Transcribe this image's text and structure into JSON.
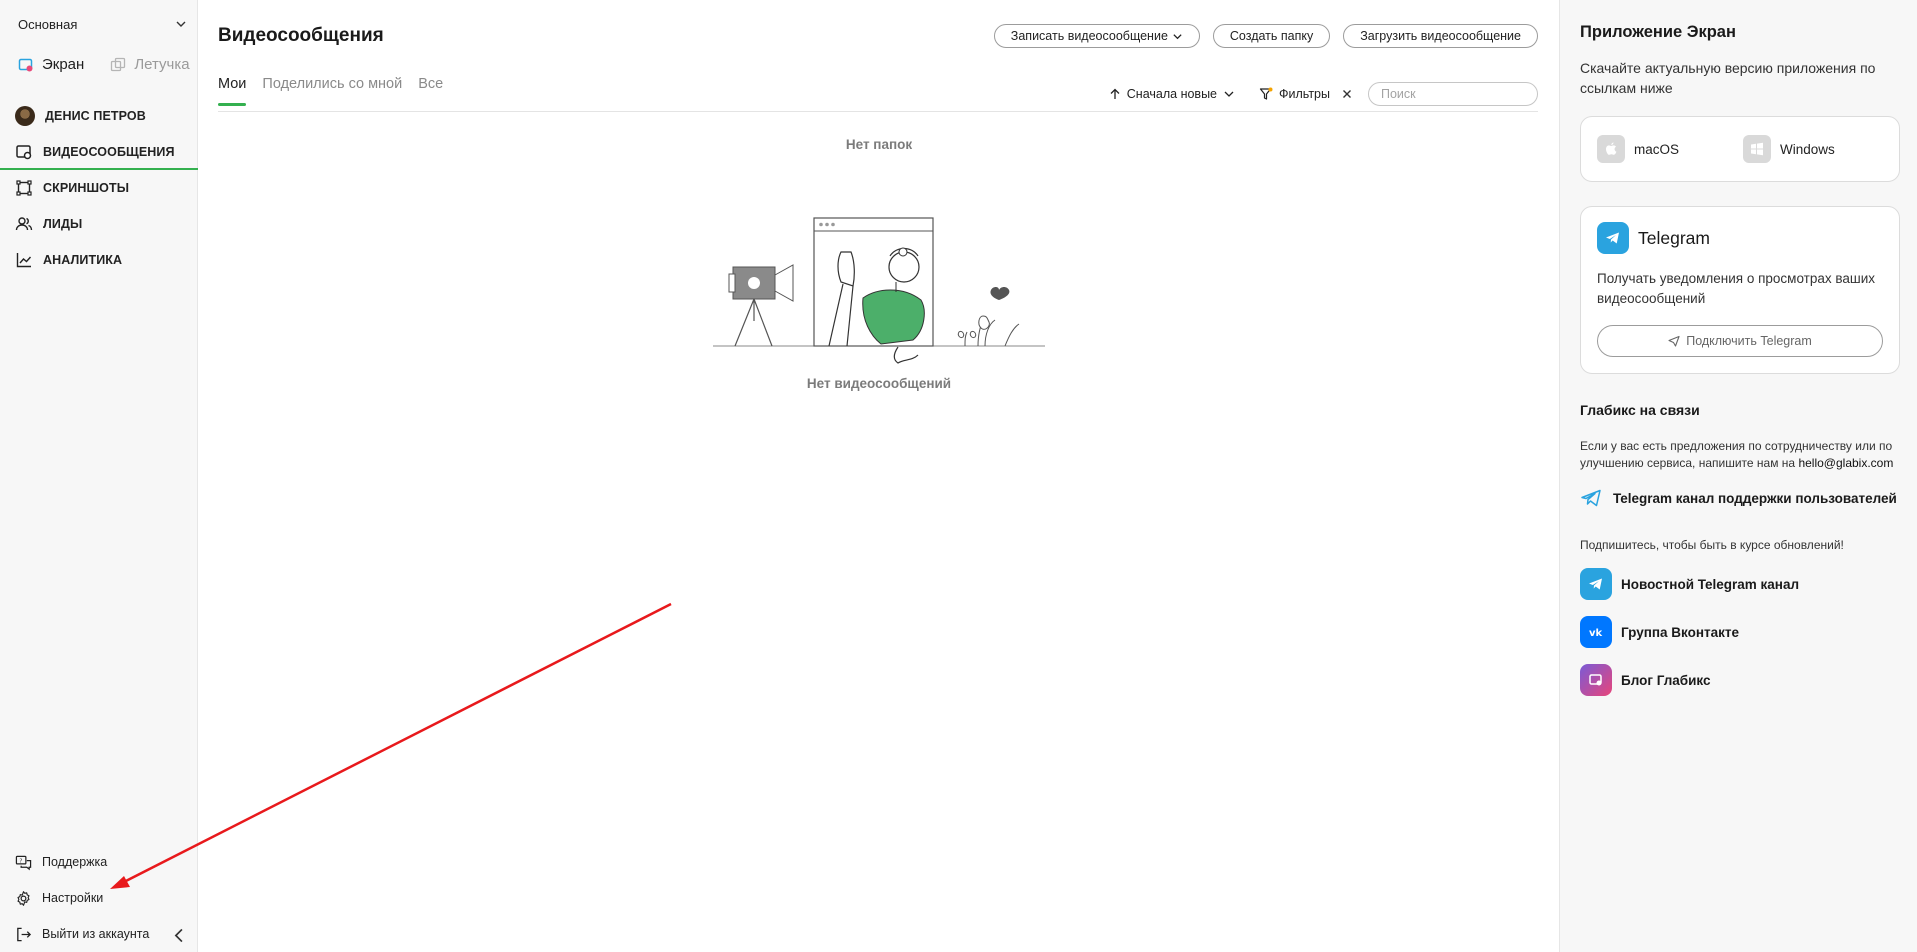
{
  "sidebar": {
    "workspace": "Основная",
    "apps": {
      "screen": "Экран",
      "letuchka": "Летучка"
    },
    "nav": [
      {
        "label": "ДЕНИС ПЕТРОВ",
        "icon": "avatar"
      },
      {
        "label": "ВИДЕОСООБЩЕНИЯ",
        "icon": "video-message-icon",
        "active": true
      },
      {
        "label": "СКРИНШОТЫ",
        "icon": "screenshot-icon"
      },
      {
        "label": "ЛИДЫ",
        "icon": "users-icon"
      },
      {
        "label": "АНАЛИТИКА",
        "icon": "chart-icon"
      }
    ],
    "bottom": {
      "support": "Поддержка",
      "settings": "Настройки",
      "logout": "Выйти из аккаунта"
    }
  },
  "main": {
    "title": "Видеосообщения",
    "buttons": {
      "record": "Записать видеосообщение",
      "create_folder": "Создать папку",
      "upload": "Загрузить видеосообщение"
    },
    "tabs": [
      {
        "label": "Мои",
        "active": true
      },
      {
        "label": "Поделились со мной"
      },
      {
        "label": "Все"
      }
    ],
    "sort_label": "Сначала новые",
    "filters_label": "Фильтры",
    "search_placeholder": "Поиск",
    "empty_folders": "Нет папок",
    "empty_videos": "Нет видеосообщений"
  },
  "right_panel": {
    "app_title": "Приложение Экран",
    "app_desc": "Скачайте актуальную версию приложения по ссылкам ниже",
    "os": {
      "mac": "macOS",
      "windows": "Windows"
    },
    "telegram": {
      "title": "Telegram",
      "desc": "Получать уведомления о просмотрах ваших видеосообщений",
      "connect": "Подключить Telegram"
    },
    "contact": {
      "title": "Глабикс на связи",
      "desc": "Если у вас есть предложения по сотрудничеству или по улучшению сервиса, напишите нам на",
      "email": "hello@glabix.com",
      "support_channel": "Telegram канал поддержки пользователей"
    },
    "subscribe": "Подпишитесь, чтобы быть в курсе обновлений!",
    "socials": {
      "telegram_news": "Новостной Telegram канал",
      "vk": "Группа Вконтакте",
      "blog": "Блог Глабикс"
    }
  },
  "colors": {
    "accent_green": "#34b04f",
    "telegram_blue": "#2aa3df",
    "vk_blue": "#0077ff",
    "annotation_red": "#e8191c"
  }
}
